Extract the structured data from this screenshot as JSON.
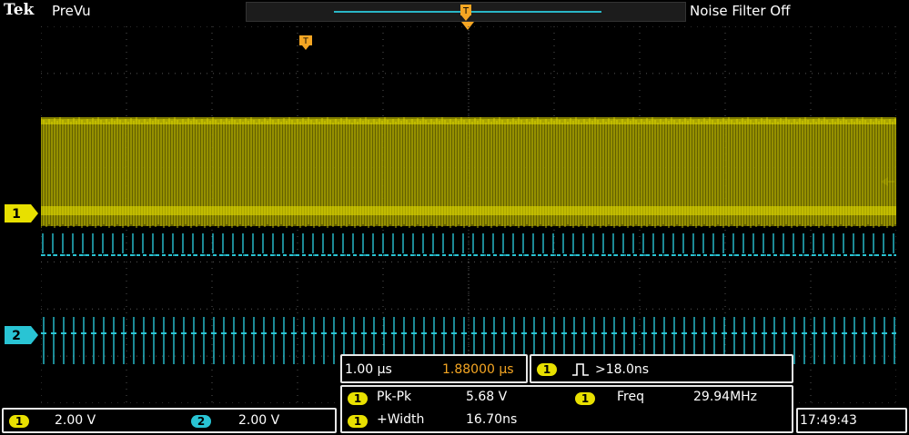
{
  "header": {
    "brand": "Tek",
    "mode": "PreVu",
    "noise_filter": "Noise Filter Off"
  },
  "channels": [
    {
      "id": "1",
      "scale": "2.00 V",
      "color": "#e8e000"
    },
    {
      "id": "2",
      "scale": "2.00 V",
      "color": "#29c4d4"
    }
  ],
  "timebase": {
    "scale": "1.00 µs",
    "position": "1.88000 µs"
  },
  "trigger": {
    "channel": "1",
    "type_icon": "pulse-width-icon",
    "condition": ">18.0ns"
  },
  "measurements": [
    {
      "channel": "1",
      "label": "Pk-Pk",
      "value": "5.68 V"
    },
    {
      "channel": "1",
      "label": "Freq",
      "value": "29.94MHz"
    },
    {
      "channel": "1",
      "label": "+Width",
      "value": "16.70ns"
    }
  ],
  "clock": "17:49:43",
  "colors": {
    "trigger_marker": "#f5a623",
    "grid": "#555555"
  }
}
